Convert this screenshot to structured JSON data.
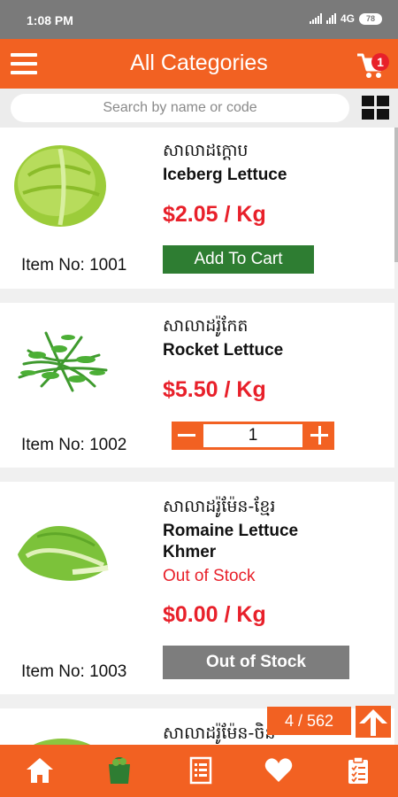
{
  "status": {
    "time": "1:08 PM",
    "network": "4G",
    "battery": "78"
  },
  "header": {
    "title": "All Categories",
    "cart_count": "1"
  },
  "search": {
    "placeholder": "Search by name or code"
  },
  "products": [
    {
      "khmer": "សាលាដក្តោប",
      "name": "Iceberg Lettuce",
      "price": "$2.05 / Kg",
      "item_no": "Item No: 1001",
      "action": "Add To Cart"
    },
    {
      "khmer": "សាលាដរ៉ូកែត",
      "name": "Rocket Lettuce",
      "price": "$5.50 / Kg",
      "item_no": "Item No: 1002",
      "quantity": "1"
    },
    {
      "khmer": "សាលាដរ៉ូម៉ែន-ខ្មែរ",
      "name": "Romaine Lettuce Khmer",
      "stock_status": "Out of Stock",
      "price": "$0.00 / Kg",
      "item_no": "Item No: 1003",
      "action": "Out of Stock"
    },
    {
      "khmer": "សាលាដរ៉ូម៉ែន-ចិន"
    }
  ],
  "pager": {
    "text": "4 / 562"
  },
  "nav": [
    "home-icon",
    "grocery-bag-icon",
    "list-icon",
    "heart-icon",
    "clipboard-check-icon"
  ],
  "colors": {
    "brand_orange": "#f26122",
    "price_red": "#e8202a",
    "cart_green": "#2e7d32",
    "disabled_gray": "#7d7d7d"
  }
}
